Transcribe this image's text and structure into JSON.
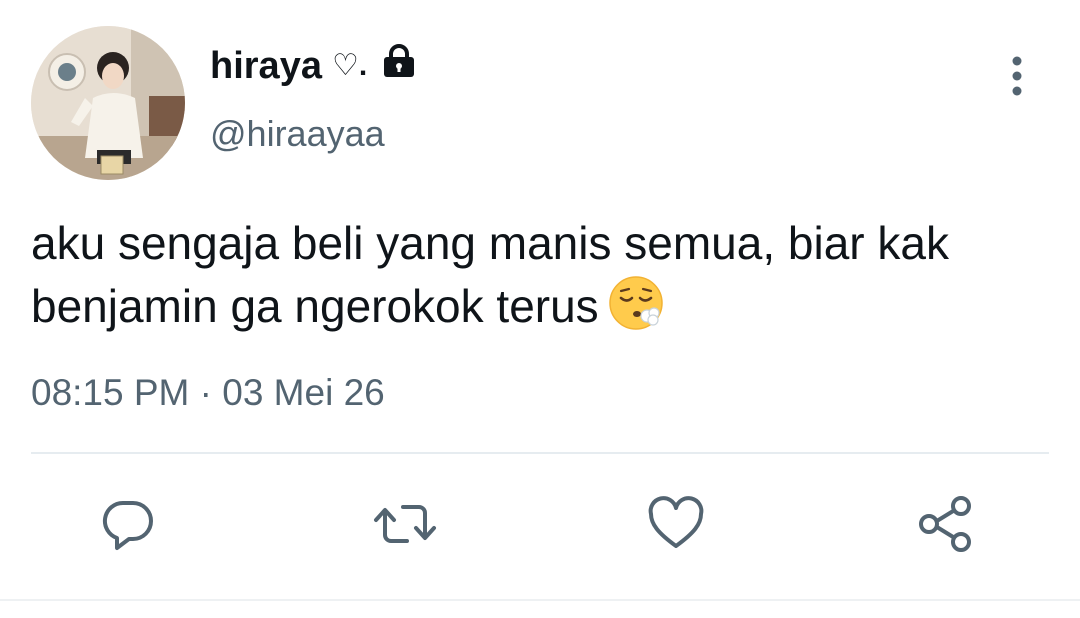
{
  "tweet": {
    "display_name": "hiraya",
    "name_suffix_glyph": "♡.",
    "handle": "@hiraayaa",
    "text": "aku sengaja beli yang manis semua, biar kak benjamin ga ngerokok terus",
    "emoji": "face-exhaling-emoji",
    "timestamp": "08:15 PM · 03 Mei 26",
    "protected": true
  },
  "icons": {
    "more": "more-vertical-icon",
    "lock": "lock-icon",
    "reply": "reply-icon",
    "retweet": "retweet-icon",
    "like": "like-icon",
    "share": "share-icon"
  },
  "colors": {
    "text_primary": "#0f1419",
    "text_secondary": "#536471",
    "icon": "#536471",
    "divider": "#e6ecf0"
  }
}
